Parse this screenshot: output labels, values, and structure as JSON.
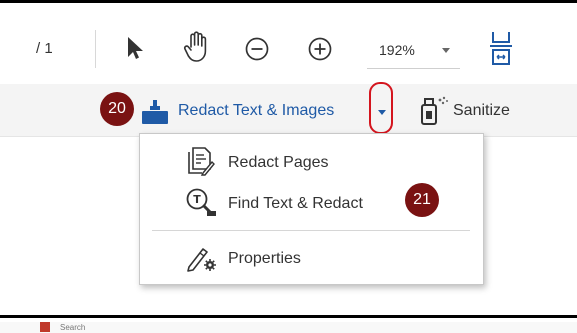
{
  "toolbar": {
    "page_count": "/ 1",
    "zoom_value": "192%"
  },
  "redact_bar": {
    "step_badge": "20",
    "redact_label": "Redact Text & Images",
    "sanitize_label": "Sanitize"
  },
  "menu": {
    "items": [
      {
        "label": "Redact Pages"
      },
      {
        "label": "Find Text & Redact"
      },
      {
        "label": "Properties"
      }
    ],
    "step_badge": "21"
  },
  "colors": {
    "accent_blue": "#1f5aa6",
    "badge_red": "#7a1212",
    "highlight_red": "#d4151e"
  },
  "bottom_window": {
    "title": "Search"
  }
}
